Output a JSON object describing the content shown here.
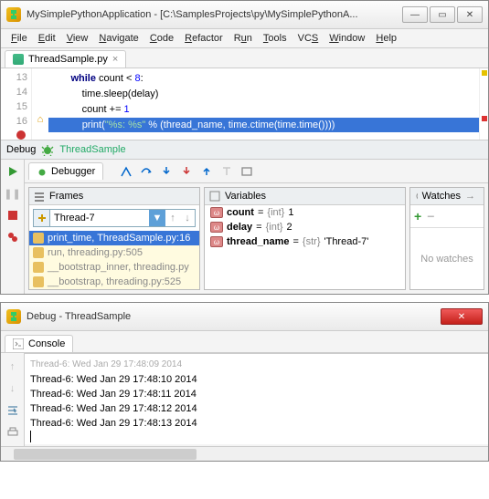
{
  "main_window": {
    "title": "MySimplePythonApplication - [C:\\SamplesProjects\\py\\MySimplePythonA...",
    "menu": [
      "File",
      "Edit",
      "View",
      "Navigate",
      "Code",
      "Refactor",
      "Run",
      "Tools",
      "VCS",
      "Window",
      "Help"
    ],
    "file_tab": "ThreadSample.py",
    "code_lines": {
      "l13": {
        "no": "13",
        "indent": "        ",
        "pre": "while",
        "mid": " count < ",
        "num": "8",
        "post": ":"
      },
      "l14": {
        "no": "14",
        "text": "            time.sleep(delay)"
      },
      "l15": {
        "no": "15",
        "indent": "            count += ",
        "num": "1"
      },
      "l16": {
        "no": "16",
        "indent": "            ",
        "fn": "print",
        "open": "(",
        "str": "\"%s: %s\"",
        "mid": " % (thread_name, time.ctime(time.time())))"
      }
    }
  },
  "debug": {
    "header_label": "Debug",
    "header_run": "ThreadSample",
    "tab": "Debugger",
    "frames": {
      "title": "Frames",
      "selected_thread": "Thread-7",
      "stack": [
        {
          "label": "print_time, ThreadSample.py:16",
          "sel": true
        },
        {
          "label": "run, threading.py:505"
        },
        {
          "label": "__bootstrap_inner, threading.py"
        },
        {
          "label": "__bootstrap, threading.py:525"
        }
      ]
    },
    "variables": {
      "title": "Variables",
      "vars": [
        {
          "name": "count",
          "type": "{int}",
          "value": "1"
        },
        {
          "name": "delay",
          "type": "{int}",
          "value": "2"
        },
        {
          "name": "thread_name",
          "type": "{str}",
          "value": "'Thread-7'"
        }
      ]
    },
    "watches": {
      "title": "Watches",
      "empty": "No watches"
    }
  },
  "console_window": {
    "title": "Debug - ThreadSample",
    "tab": "Console",
    "lines": [
      "Thread-6: Wed Jan 29 17:48:10 2014",
      "Thread-6: Wed Jan 29 17:48:11 2014",
      "Thread-6: Wed Jan 29 17:48:12 2014",
      "Thread-6: Wed Jan 29 17:48:13 2014"
    ]
  }
}
